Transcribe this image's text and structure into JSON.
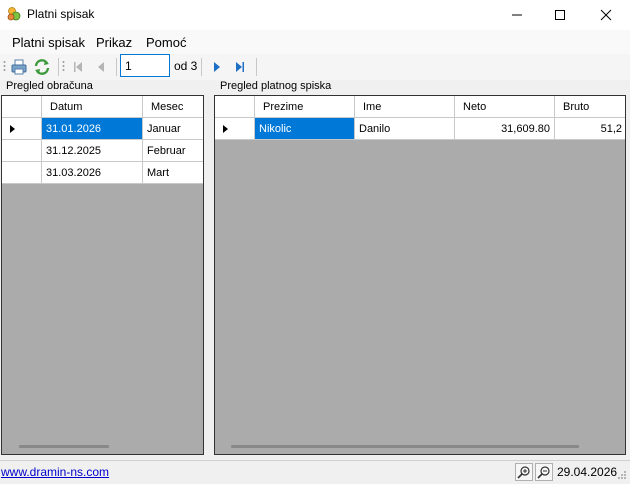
{
  "window": {
    "title": "Platni spisak"
  },
  "menu": [
    "Platni spisak",
    "Prikaz",
    "Pomoć"
  ],
  "navigator": {
    "current_page": "1",
    "of_label": "od 3"
  },
  "left_panel": {
    "title": "Pregled obračuna",
    "columns": [
      "Datum",
      "Mesec"
    ],
    "rows": [
      {
        "datum": "31.01.2026",
        "mesec": "Januar"
      },
      {
        "datum": "31.12.2025",
        "mesec": "Februar"
      },
      {
        "datum": "31.03.2026",
        "mesec": "Mart"
      }
    ]
  },
  "right_panel": {
    "title": "Pregled platnog spiska",
    "columns": [
      "Prezime",
      "Ime",
      "Neto",
      "Bruto"
    ],
    "rows": [
      {
        "prezime": "Nikolic",
        "ime": "Danilo",
        "neto": "31,609.80",
        "bruto": "51,2"
      }
    ]
  },
  "status": {
    "link": "www.dramin-ns.com",
    "date": "29.04.2026"
  },
  "colors": {
    "selection": "#0078d7",
    "grid_background": "#ababab"
  },
  "icons": [
    "app-icon",
    "minimize-icon",
    "maximize-icon",
    "close-icon",
    "print-icon",
    "refresh-icon",
    "first-page-icon",
    "previous-page-icon",
    "next-page-icon",
    "last-page-icon",
    "zoom-in-icon",
    "zoom-out-icon",
    "resize-grip-icon"
  ]
}
